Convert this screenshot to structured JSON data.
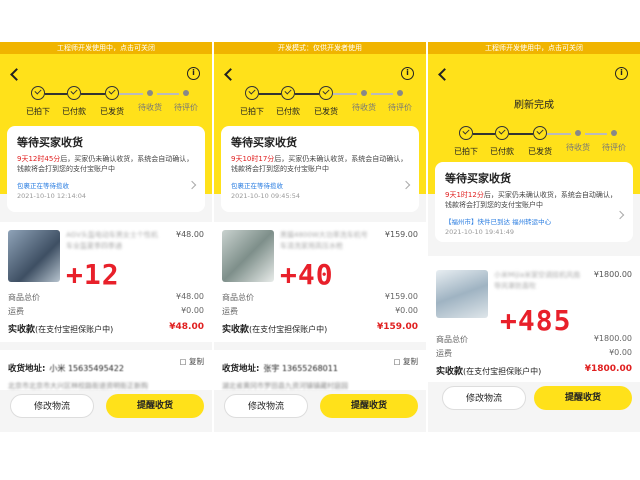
{
  "panels": [
    {
      "banner": "工程师开发使用中，点击可关闭",
      "refresh": "",
      "steps": [
        "已拍下",
        "已付款",
        "已发货",
        "待收货",
        "待评价"
      ],
      "status_title": "等待买家收货",
      "status_time": "9天12时45分",
      "status_text": "后，买家仍未确认收货，系统会自动确认，钱款将会打到您的支付宝账户中",
      "track": "包裹正在等待揽收",
      "track_time": "2021-10-10 12:14:04",
      "goods_name": "AGV头盔电动车男女士个性机车全盔夏季四季通",
      "goods_price": "¥48.00",
      "overlay": "+12",
      "total_label": "商品总价",
      "total_value": "¥48.00",
      "freight_label": "运费",
      "freight_value": "¥0.00",
      "paid_label": "实收款",
      "paid_note": "(在支付宝担保账户中)",
      "paid_value": "¥48.00",
      "addr_label": "收货地址:",
      "addr_name": "小米  15635495422",
      "copy_label": "复制",
      "addr_line": "北京市北京市大兴区林校路街道资明街正新购",
      "btn_logistics": "修改物流",
      "btn_remind": "提醒收货"
    },
    {
      "banner": "开发模式：仅供开发者使用",
      "refresh": "",
      "steps": [
        "已拍下",
        "已付款",
        "已发货",
        "待收货",
        "待评价"
      ],
      "status_title": "等待买家收货",
      "status_time": "9天10时17分",
      "status_text": "后，买家仍未确认收货，系统会自动确认，钱款将会打到您的支付宝账户中",
      "track": "包裹正在等待揽收",
      "track_time": "2021-10-10 09:45:54",
      "goods_name": "黑猫4800W大功率洗车机号车清洗家用高压水枪",
      "goods_price": "¥159.00",
      "overlay": "+40",
      "total_label": "商品总价",
      "total_value": "¥159.00",
      "freight_label": "运费",
      "freight_value": "¥0.00",
      "paid_label": "实收款",
      "paid_note": "(在支付宝担保账户中)",
      "paid_value": "¥159.00",
      "addr_label": "收货地址:",
      "addr_name": "张宇  13655268011",
      "copy_label": "复制",
      "addr_line": "湖北省黄冈市罗田县九资河镇镇藏村庭园",
      "btn_logistics": "修改物流",
      "btn_remind": "提醒收货"
    },
    {
      "banner": "工程师开发使用中，点击可关闭",
      "refresh": "刷新完成",
      "steps": [
        "已拍下",
        "已付款",
        "已发货",
        "待收货",
        "待评价"
      ],
      "status_title": "等待买家收货",
      "status_time": "9天1时12分",
      "status_text": "后，买家仍未确认收货，系统会自动确认，钱款将会打到您的支付宝账户中",
      "track": "【福州市】快件已到达 福州转运中心",
      "track_time": "2021-10-10 19:41:49",
      "goods_name": "小米Mijia米家空调挂机风扇导风罩防直吹",
      "goods_price": "¥1800.00",
      "overlay": "+485",
      "total_label": "商品总价",
      "total_value": "¥1800.00",
      "freight_label": "运费",
      "freight_value": "¥0.00",
      "paid_label": "实收款",
      "paid_note": "(在支付宝担保账户中)",
      "paid_value": "¥1800.00",
      "addr_label": "",
      "addr_name": "",
      "copy_label": "",
      "addr_line": "",
      "btn_logistics": "修改物流",
      "btn_remind": "提醒收货"
    }
  ],
  "icons": {
    "back": "chevron-left-icon",
    "info": "info-icon",
    "copy": "copy-icon"
  },
  "colors": {
    "accent": "#ffe11a",
    "price_red": "#e02020",
    "overlay_red": "#e8202a",
    "link_blue": "#2a7de1"
  }
}
